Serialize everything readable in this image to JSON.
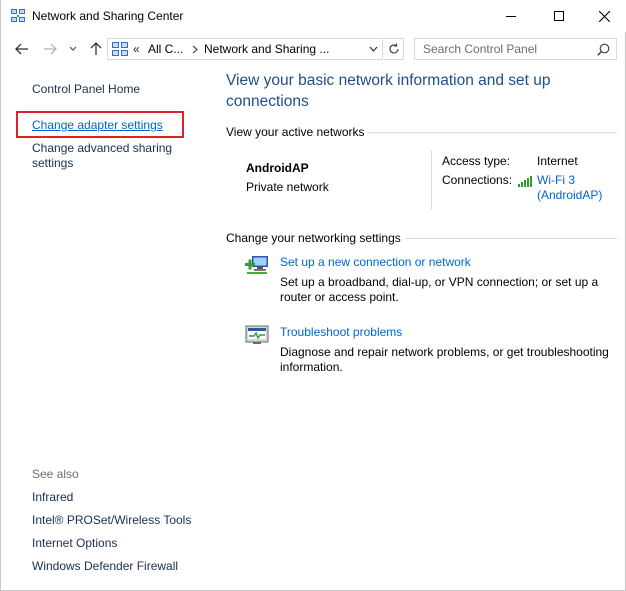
{
  "window": {
    "title": "Network and Sharing Center"
  },
  "address": {
    "overflow": "«",
    "crumbs": [
      "All C...",
      "Network and Sharing ..."
    ],
    "search_placeholder": "Search Control Panel"
  },
  "left_pane": {
    "home": "Control Panel Home",
    "adapter": "Change adapter settings",
    "advanced": "Change advanced sharing settings",
    "see_also_heading": "See also",
    "see_also": [
      "Infrared",
      "Intel® PROSet/Wireless Tools",
      "Internet Options",
      "Windows Defender Firewall"
    ]
  },
  "main": {
    "title": "View your basic network information and set up connections",
    "active_heading": "View your active networks",
    "network": {
      "name": "AndroidAP",
      "type": "Private network",
      "access_label": "Access type:",
      "access_value": "Internet",
      "connections_label": "Connections:",
      "connection_line1": "Wi-Fi 3",
      "connection_line2": "(AndroidAP)"
    },
    "change_heading": "Change your networking settings",
    "tasks": [
      {
        "link": "Set up a new connection or network",
        "desc": "Set up a broadband, dial-up, or VPN connection; or set up a router or access point."
      },
      {
        "link": "Troubleshoot problems",
        "desc": "Diagnose and repair network problems, or get troubleshooting information."
      }
    ]
  },
  "colors": {
    "link": "#0066cc",
    "title_blue": "#1e4e8c",
    "highlight": "#e0202b"
  },
  "icons": [
    "network-center-icon",
    "minimize-icon",
    "maximize-icon",
    "close-icon",
    "back-arrow-icon",
    "forward-arrow-icon",
    "recent-dropdown-icon",
    "up-arrow-icon",
    "control-panel-icon",
    "chevron-right-icon",
    "chevron-down-icon",
    "refresh-icon",
    "search-icon",
    "wifi-signal-icon",
    "new-connection-icon",
    "troubleshoot-icon"
  ]
}
